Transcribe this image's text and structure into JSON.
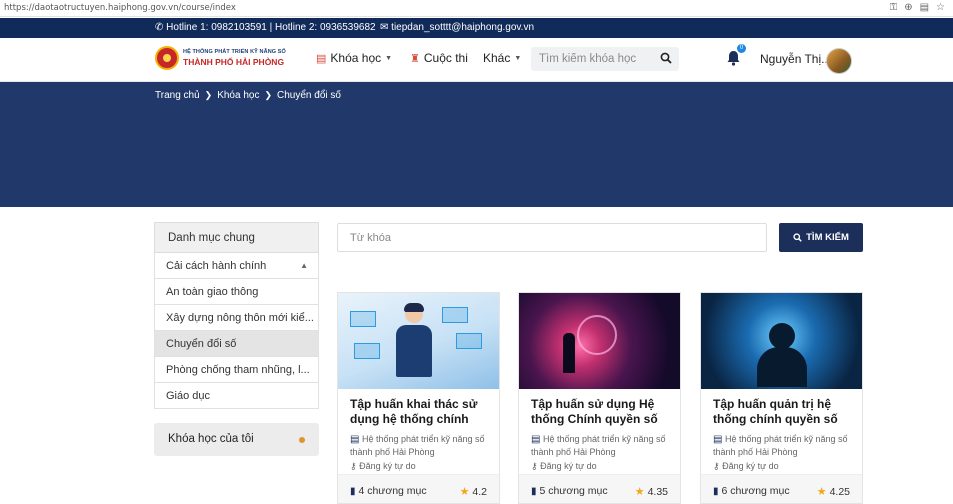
{
  "browser": {
    "url": "https://daotaotructuyen.haiphong.gov.vn/course/index"
  },
  "topbar": {
    "hotline": "Hotline 1: 0982103591 | Hotline 2: 0936539682",
    "email": "tiepdan_sotttt@haiphong.gov.vn"
  },
  "logo": {
    "line1": "HỆ THỐNG PHÁT TRIỂN KỸ NĂNG SỐ",
    "line2": "THÀNH PHỐ HẢI PHÒNG"
  },
  "nav": {
    "courses": "Khóa học",
    "contest": "Cuộc thi",
    "other": "Khác",
    "search_placeholder": "Tìm kiếm khóa học",
    "notification_count": "0",
    "user_name": "Nguyễn Thị..."
  },
  "breadcrumb": [
    "Trang chủ",
    "Khóa học",
    "Chuyển đổi số"
  ],
  "sidebar": {
    "heading": "Danh mục chung",
    "categories": [
      "Cải cách hành chính",
      "An toàn giao thông",
      "Xây dựng nông thôn mới kiể...",
      "Chuyển đổi số",
      "Phòng chống tham nhũng, l...",
      "Giáo dục"
    ],
    "my_courses": "Khóa học của tôi"
  },
  "filter": {
    "keyword_placeholder": "Từ khóa",
    "search_button": "TÌM KIẾM"
  },
  "courses": [
    {
      "title": "Tập huấn khai thác sử dụng hệ thống chính",
      "org": "Hệ thống phát triển kỹ năng số thành phố Hải Phòng",
      "enroll": "Đăng ký tự do",
      "chapters": "4 chương mục",
      "rating": "4.2"
    },
    {
      "title": "Tập huấn sử dụng Hệ thống Chính quyền số",
      "org": "Hệ thống phát triển kỹ năng số thành phố Hải Phòng",
      "enroll": "Đăng ký tự do",
      "chapters": "5 chương mục",
      "rating": "4.35"
    },
    {
      "title": "Tập huấn quản trị hệ thống chính quyền số",
      "org": "Hệ thống phát triển kỹ năng số thành phố Hải Phòng",
      "enroll": "Đăng ký tự do",
      "chapters": "6 chương mục",
      "rating": "4.25"
    }
  ],
  "colors": {
    "navy": "#102a5a",
    "hero": "#21396a",
    "star": "#f0a81b",
    "accent_red": "#d84a3a"
  },
  "icons": [
    "phone-icon",
    "mail-icon",
    "book-icon",
    "trophy-icon",
    "search-icon",
    "bell-icon",
    "star-icon",
    "key-icon"
  ]
}
